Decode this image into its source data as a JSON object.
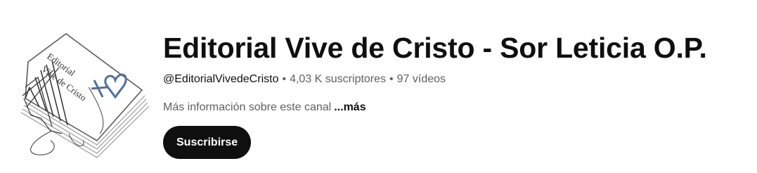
{
  "channel": {
    "title": "Editorial Vive de Cristo - Sor Leticia O.P.",
    "handle": "@EditorialVivedeCristo",
    "separator": "•",
    "subscribers": "4,03 K suscriptores",
    "videos": "97 vídeos",
    "description_preview": "Más información sobre este canal",
    "more_label": "...más",
    "subscribe_label": "Suscribirse"
  },
  "avatar": {
    "text_line_1": "Editorial",
    "text_line_2": "Vive de Cristo",
    "icon": "book-with-heart-logo",
    "heart_color": "#4f6f98"
  },
  "colors": {
    "primary_text": "#0f0f0f",
    "secondary_text": "#606060",
    "button_bg": "#0f0f0f",
    "button_text": "#ffffff"
  }
}
